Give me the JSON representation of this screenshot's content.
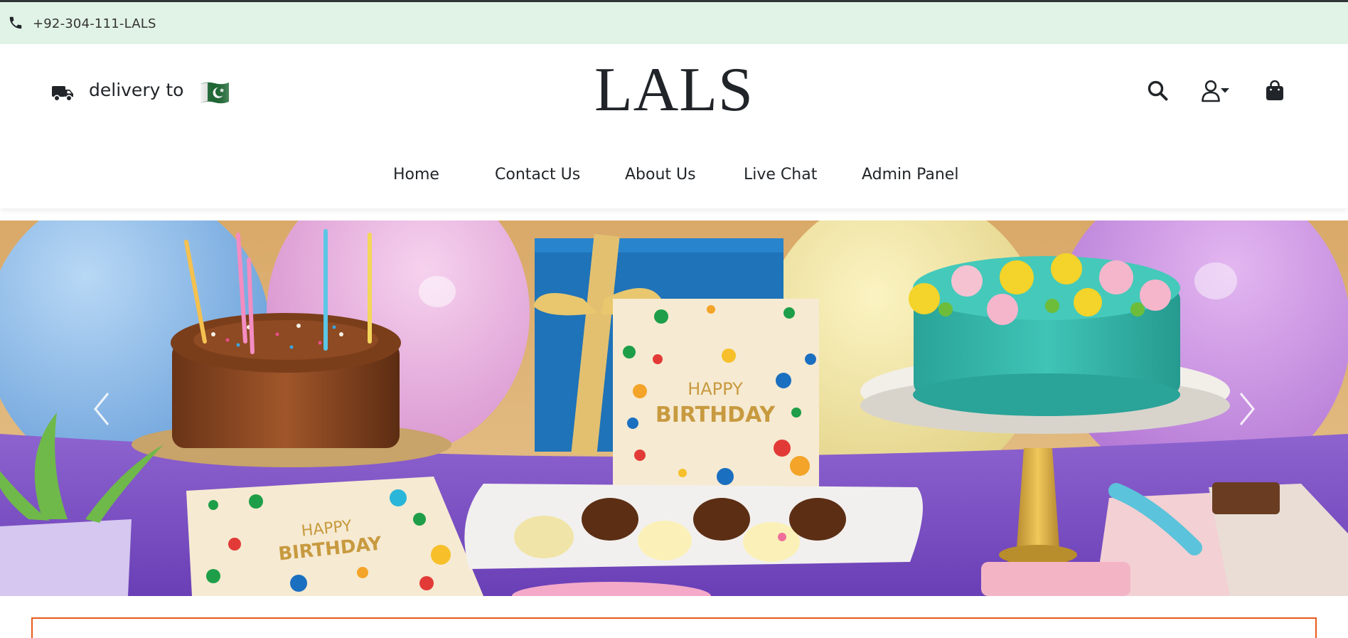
{
  "topbar": {
    "phone": "+92-304-111-LALS",
    "icon": "phone-icon"
  },
  "header": {
    "delivery_label": "delivery to",
    "delivery_icon": "truck-icon",
    "flag_icon": "pakistan-flag-icon",
    "logo": "LALS",
    "icons": [
      "search-icon",
      "user-dropdown-icon",
      "shopping-bag-icon"
    ]
  },
  "nav": {
    "items": [
      {
        "label": "Home"
      },
      {
        "label": "Contact Us"
      },
      {
        "label": "About Us"
      },
      {
        "label": "Live Chat"
      },
      {
        "label": "Admin Panel"
      }
    ]
  },
  "hero": {
    "box_text_1": "HAPPY",
    "box_text_2": "BIRTHDAY",
    "ribbon_text": "Happy Birthday",
    "prev_icon": "chevron-left-icon",
    "next_icon": "chevron-right-icon"
  },
  "colors": {
    "topbar_bg": "#e1f3e6",
    "accent_border": "#e8591a",
    "text": "#212529"
  }
}
